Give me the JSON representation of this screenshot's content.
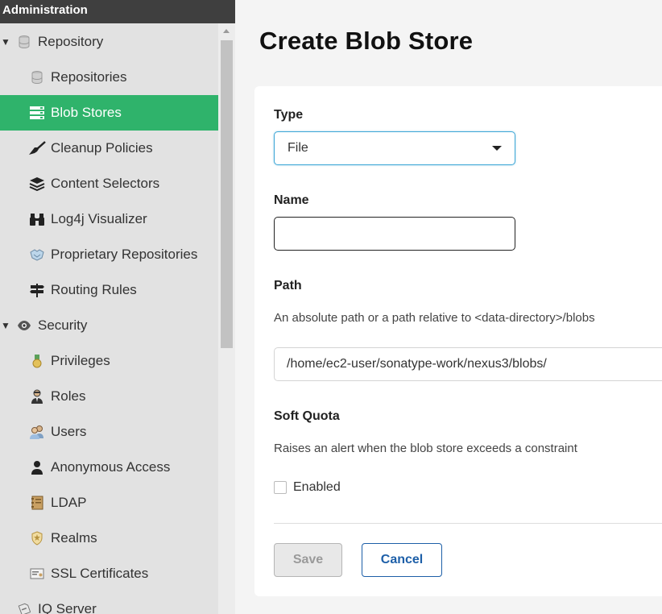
{
  "sidebar": {
    "header": "Administration",
    "items": [
      {
        "label": "Repository",
        "icon": "database-icon",
        "expanded": true
      },
      {
        "label": "Repositories",
        "icon": "database-icon"
      },
      {
        "label": "Blob Stores",
        "icon": "server-icon",
        "selected": true
      },
      {
        "label": "Cleanup Policies",
        "icon": "broom-icon"
      },
      {
        "label": "Content Selectors",
        "icon": "layers-icon"
      },
      {
        "label": "Log4j Visualizer",
        "icon": "binoculars-icon"
      },
      {
        "label": "Proprietary Repositories",
        "icon": "handshake-icon"
      },
      {
        "label": "Routing Rules",
        "icon": "signpost-icon"
      },
      {
        "label": "Security",
        "icon": "eye-icon",
        "expanded": true
      },
      {
        "label": "Privileges",
        "icon": "medal-icon"
      },
      {
        "label": "Roles",
        "icon": "user-tie-icon"
      },
      {
        "label": "Users",
        "icon": "users-icon"
      },
      {
        "label": "Anonymous Access",
        "icon": "user-icon"
      },
      {
        "label": "LDAP",
        "icon": "address-book-icon"
      },
      {
        "label": "Realms",
        "icon": "shield-icon"
      },
      {
        "label": "SSL Certificates",
        "icon": "certificate-icon"
      },
      {
        "label": "IQ Server",
        "icon": "iq-server-icon"
      }
    ]
  },
  "main": {
    "title": "Create Blob Store",
    "form": {
      "type_label": "Type",
      "type_value": "File",
      "name_label": "Name",
      "name_value": "",
      "path_label": "Path",
      "path_help": "An absolute path or a path relative to <data-directory>/blobs",
      "path_value": "/home/ec2-user/sonatype-work/nexus3/blobs/",
      "quota_label": "Soft Quota",
      "quota_help": "Raises an alert when the blob store exceeds a constraint",
      "enabled_label": "Enabled",
      "enabled_checked": false
    },
    "buttons": {
      "save": "Save",
      "cancel": "Cancel"
    }
  },
  "colors": {
    "accent": "#2fb36b",
    "header_bg": "#3f3f3f",
    "link": "#1d5fa8",
    "focus": "#3fa7d6"
  }
}
